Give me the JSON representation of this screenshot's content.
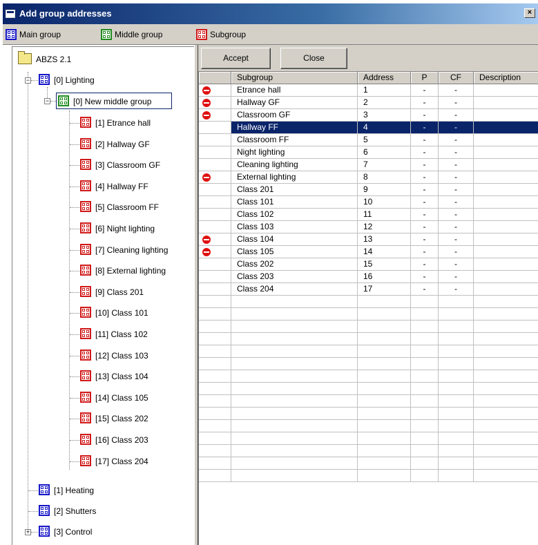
{
  "window": {
    "title": "Add group addresses",
    "close_glyph": "×"
  },
  "tabs": [
    {
      "label": "Main group",
      "icon": "main-group-icon",
      "color": "#1414c8"
    },
    {
      "label": "Middle group",
      "icon": "middle-group-icon",
      "color": "#208c20"
    },
    {
      "label": "Subgroup",
      "icon": "subgroup-icon",
      "color": "#d01818"
    }
  ],
  "tree": {
    "root": "ABZS 2.1",
    "main_groups": [
      "[0] Lighting",
      "[1] Heating",
      "[2] Shutters",
      "[3] Control"
    ],
    "middle_group": "[0] New middle group",
    "subgroups": [
      "[1] Etrance hall",
      "[2] Hallway GF",
      "[3] Classroom GF",
      "[4] Hallway FF",
      "[5] Classroom FF",
      "[6] Night lighting",
      "[7] Cleaning lighting",
      "[8] External lighting",
      "[9] Class 201",
      "[10] Class 101",
      "[11] Class 102",
      "[12] Class 103",
      "[13] Class 104",
      "[14] Class 105",
      "[15] Class 202",
      "[16] Class 203",
      "[17] Class 204"
    ],
    "expander_minus": "−",
    "expander_plus": "+"
  },
  "buttons": {
    "accept": "Accept",
    "close": "Close"
  },
  "table": {
    "columns": [
      "Subgroup",
      "Address",
      "P",
      "CF",
      "Description"
    ],
    "rows": [
      {
        "subgroup": "Etrance hall",
        "address": "1",
        "p": "-",
        "cf": "-",
        "blocked": true
      },
      {
        "subgroup": "Hallway GF",
        "address": "2",
        "p": "-",
        "cf": "-",
        "blocked": true
      },
      {
        "subgroup": "Classroom GF",
        "address": "3",
        "p": "-",
        "cf": "-",
        "blocked": true
      },
      {
        "subgroup": "Hallway FF",
        "address": "4",
        "p": "-",
        "cf": "-",
        "blocked": false,
        "selected": true
      },
      {
        "subgroup": "Classroom FF",
        "address": "5",
        "p": "-",
        "cf": "-",
        "blocked": false
      },
      {
        "subgroup": "Night lighting",
        "address": "6",
        "p": "-",
        "cf": "-",
        "blocked": false
      },
      {
        "subgroup": "Cleaning lighting",
        "address": "7",
        "p": "-",
        "cf": "-",
        "blocked": false
      },
      {
        "subgroup": "External lighting",
        "address": "8",
        "p": "-",
        "cf": "-",
        "blocked": true
      },
      {
        "subgroup": "Class 201",
        "address": "9",
        "p": "-",
        "cf": "-",
        "blocked": false
      },
      {
        "subgroup": "Class 101",
        "address": "10",
        "p": "-",
        "cf": "-",
        "blocked": false
      },
      {
        "subgroup": "Class 102",
        "address": "11",
        "p": "-",
        "cf": "-",
        "blocked": false
      },
      {
        "subgroup": "Class 103",
        "address": "12",
        "p": "-",
        "cf": "-",
        "blocked": false
      },
      {
        "subgroup": "Class 104",
        "address": "13",
        "p": "-",
        "cf": "-",
        "blocked": true
      },
      {
        "subgroup": "Class 105",
        "address": "14",
        "p": "-",
        "cf": "-",
        "blocked": true
      },
      {
        "subgroup": "Class 202",
        "address": "15",
        "p": "-",
        "cf": "-",
        "blocked": false
      },
      {
        "subgroup": "Class 203",
        "address": "16",
        "p": "-",
        "cf": "-",
        "blocked": false
      },
      {
        "subgroup": "Class 204",
        "address": "17",
        "p": "-",
        "cf": "-",
        "blocked": false
      }
    ],
    "empty_rows": 15
  },
  "colors": {
    "title_bar": "#0a246a",
    "selection": "#0a246a",
    "blocked_icon": "#e01010"
  }
}
